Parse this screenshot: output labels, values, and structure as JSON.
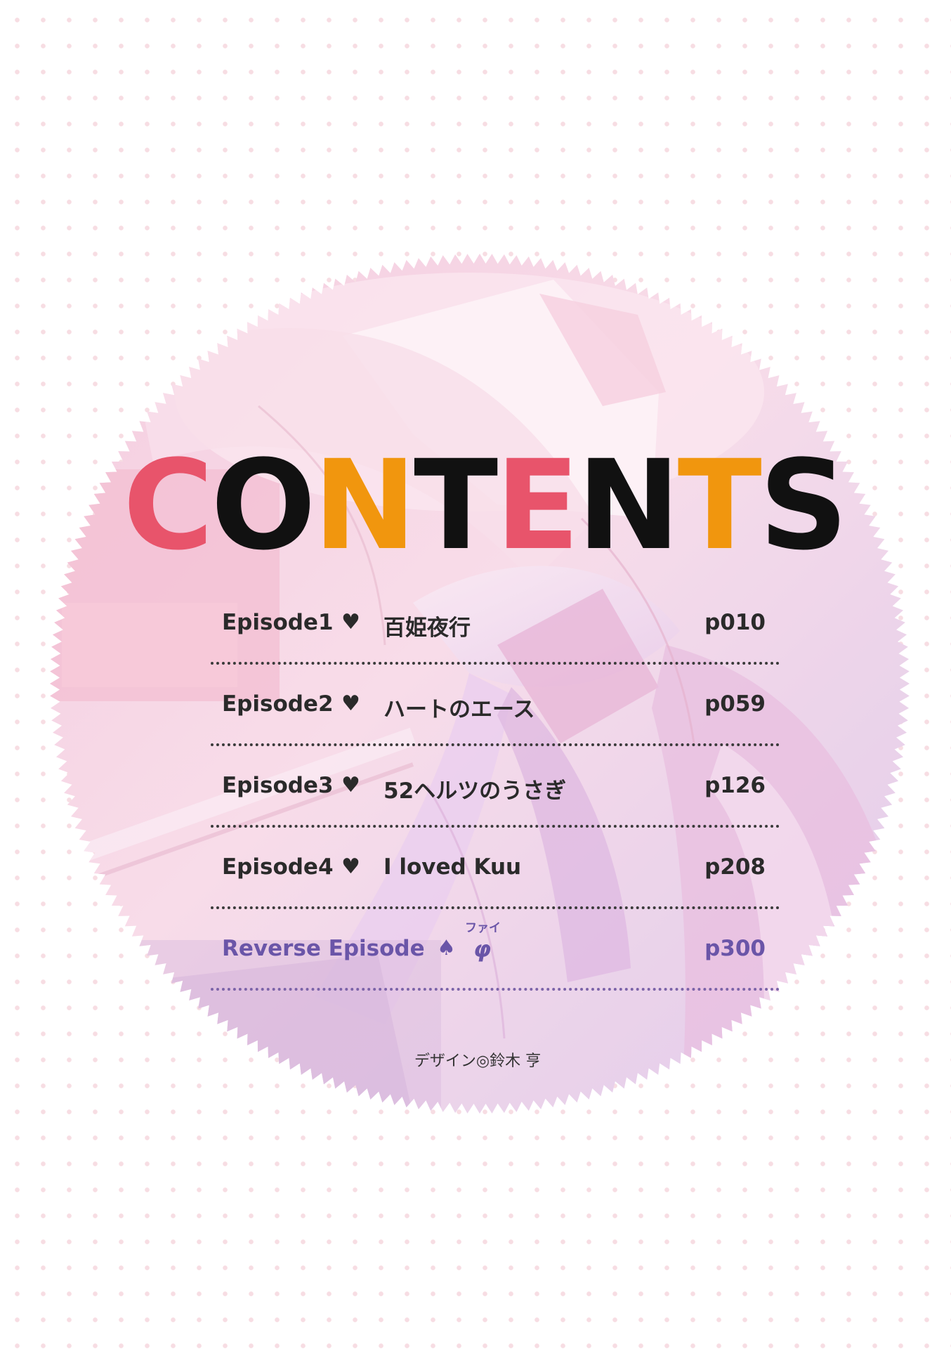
{
  "colors": {
    "pink": "#e8546b",
    "black": "#111111",
    "orange": "#f1960e",
    "text": "#2a2a2a",
    "reverse": "#6a55a8"
  },
  "title": {
    "letters": [
      {
        "char": "C",
        "color": "#e8546b"
      },
      {
        "char": "O",
        "color": "#111111"
      },
      {
        "char": "N",
        "color": "#f1960e"
      },
      {
        "char": "T",
        "color": "#111111"
      },
      {
        "char": "E",
        "color": "#e8546b"
      },
      {
        "char": "N",
        "color": "#111111"
      },
      {
        "char": "T",
        "color": "#f1960e"
      },
      {
        "char": "S",
        "color": "#111111"
      }
    ]
  },
  "toc": [
    {
      "label": "Episode1",
      "mark": "♥",
      "title": "百姫夜行",
      "page": "p010"
    },
    {
      "label": "Episode2",
      "mark": "♥",
      "title": "ハートのエース",
      "page": "p059"
    },
    {
      "label": "Episode3",
      "mark": "♥",
      "title": "52ヘルツのうさぎ",
      "page": "p126"
    },
    {
      "label": "Episode4",
      "mark": "♥",
      "title": "I loved Kuu",
      "page": "p208"
    },
    {
      "label": "Reverse Episode",
      "mark": "♠",
      "title": "φ",
      "ruby": "ファイ",
      "page": "p300"
    }
  ],
  "credit": "デザイン◎鈴木 亨"
}
